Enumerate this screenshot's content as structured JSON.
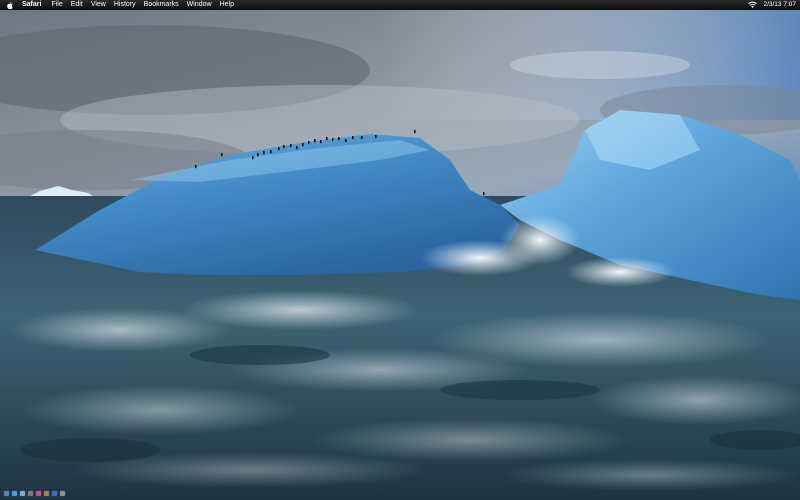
{
  "menubar": {
    "apple_icon": "apple-icon",
    "app_name": "Safari",
    "items": [
      "File",
      "Edit",
      "View",
      "History",
      "Bookmarks",
      "Window",
      "Help"
    ],
    "wifi_icon": "wifi-icon",
    "clock": "2/3/13 7:07"
  },
  "desktop": {
    "wallpaper": "iceberg-penguins-wallpaper"
  },
  "dock": {
    "icons": [
      {
        "name": "finder-icon",
        "color": "#5a7fb8"
      },
      {
        "name": "safari-icon",
        "color": "#4aa0d8"
      },
      {
        "name": "mail-icon",
        "color": "#8aa8c8"
      },
      {
        "name": "system-preferences-icon",
        "color": "#7a7a7a"
      },
      {
        "name": "itunes-icon",
        "color": "#c0508a"
      },
      {
        "name": "photos-icon",
        "color": "#a08050"
      },
      {
        "name": "app-store-icon",
        "color": "#3a70c0"
      },
      {
        "name": "trash-icon",
        "color": "#909090"
      }
    ]
  }
}
